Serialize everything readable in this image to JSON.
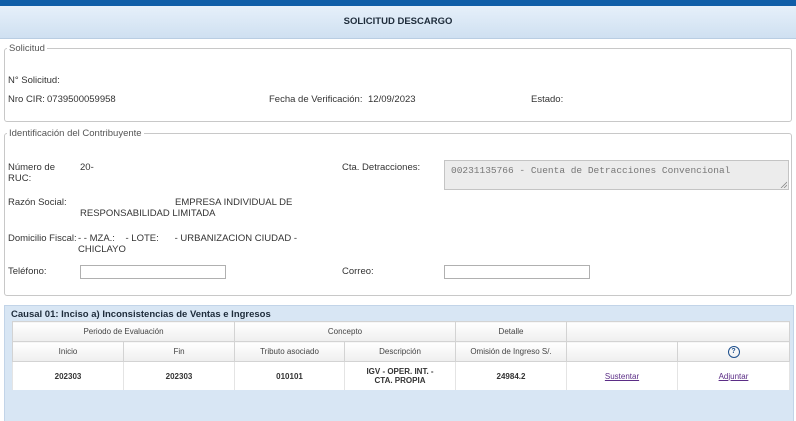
{
  "header": {
    "title": "SOLICITUD DESCARGO"
  },
  "solicitud": {
    "legend": "Solicitud",
    "nro_solicitud_label": "N° Solicitud:",
    "nro_cir_label": "Nro CIR:",
    "nro_cir_value": "0739500059958",
    "fecha_label": "Fecha de Verificación:",
    "fecha_value": "12/09/2023",
    "estado_label": "Estado:"
  },
  "contribuyente": {
    "legend": "Identificación del Contribuyente",
    "ruc_label": "Número de RUC:",
    "ruc_value": "20-",
    "razon_label": "Razón Social:",
    "razon_value": "EMPRESA INDIVIDUAL DE RESPONSABILIDAD LIMITADA",
    "domicilio_label": "Domicilio Fiscal:",
    "domicilio_value": "- - MZA.:    - LOTE:      - URBANIZACION CIUDAD - CHICLAYO",
    "telefono_label": "Teléfono:",
    "telefono_value": "",
    "detracciones_label": "Cta. Detracciones:",
    "detracciones_value": "00231135766 - Cuenta de Detracciones Convencional",
    "correo_label": "Correo:",
    "correo_value": ""
  },
  "causal": {
    "title": "Causal 01: Inciso a) Inconsistencias de Ventas e Ingresos",
    "group_headers": [
      "Periodo de Evaluación",
      "Concepto",
      "Detalle"
    ],
    "columns": [
      "Inicio",
      "Fin",
      "Tributo asociado",
      "Descripción",
      "Omisión de Ingreso S/."
    ],
    "help_glyph": "?",
    "rows": [
      {
        "inicio": "202303",
        "fin": "202303",
        "tributo": "010101",
        "descripcion": "IGV - OPER. INT. - CTA. PROPIA",
        "omision": "24984.2",
        "sustentar": "Sustentar",
        "adjuntar": "Adjuntar"
      }
    ]
  }
}
